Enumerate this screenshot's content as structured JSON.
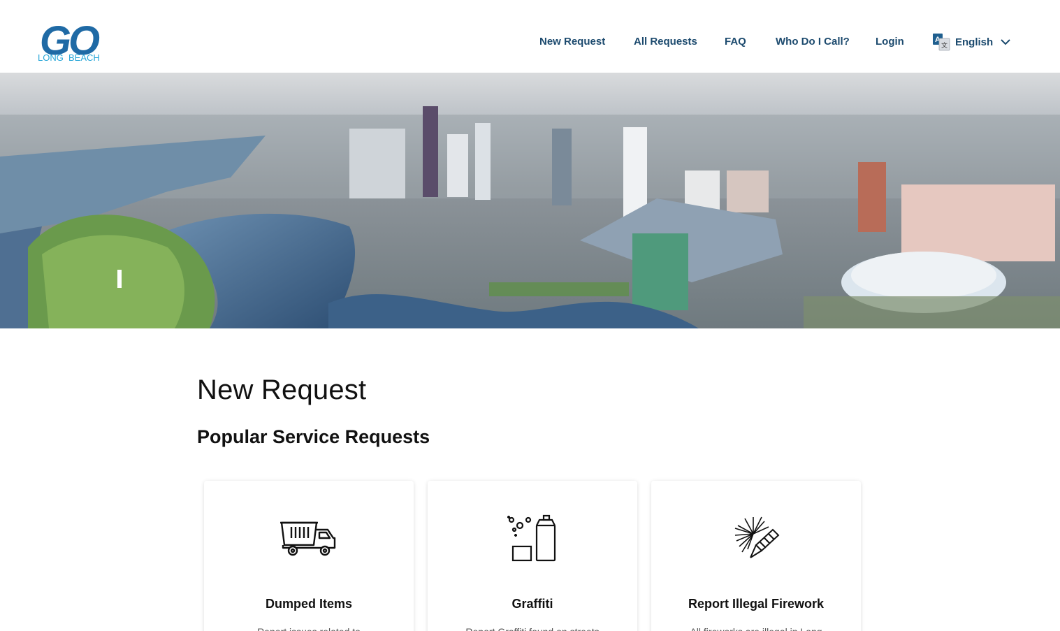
{
  "logo": {
    "text_top": "GO",
    "text_bottom_left": "LONG",
    "text_bottom_right": "BEACH",
    "brand_color": "#1f6aa5",
    "accent_color": "#2aa7d8"
  },
  "nav": {
    "items": [
      {
        "label": "New Request"
      },
      {
        "label": "All Requests"
      },
      {
        "label": "FAQ"
      },
      {
        "label": "Who Do I Call?"
      },
      {
        "label": "Login"
      }
    ],
    "language": {
      "selected": "English",
      "icon": "translate-icon"
    }
  },
  "hero": {
    "icon": "city-aerial-photo"
  },
  "main": {
    "title": "New Request",
    "section_title": "Popular Service Requests",
    "cards": [
      {
        "title": "Dumped Items",
        "description": "Report issues related to",
        "icon": "dump-truck-icon"
      },
      {
        "title": "Graffiti",
        "description": "Report Graffiti found on streets",
        "icon": "spray-paint-icon"
      },
      {
        "title": "Report Illegal Firework",
        "description": "All fireworks are illegal in Long",
        "icon": "firework-icon"
      }
    ]
  },
  "colors": {
    "nav_text": "#1c4a6e",
    "heading": "#111111"
  }
}
